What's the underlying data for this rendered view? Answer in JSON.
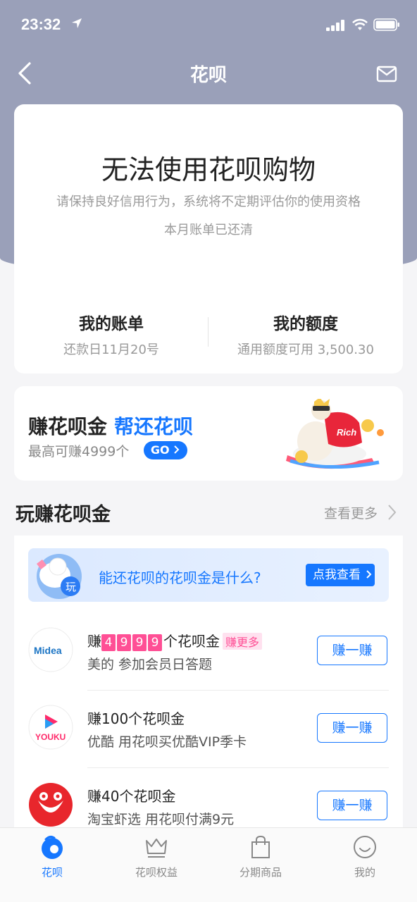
{
  "status_bar": {
    "time": "23:32"
  },
  "nav": {
    "title": "花呗"
  },
  "status_card": {
    "title": "无法使用花呗购物",
    "description": "请保持良好信用行为，系统将不定期评估你的使用资格",
    "note": "本月账单已还清",
    "bill": {
      "title": "我的账单",
      "subtitle": "还款日11月20号"
    },
    "limit": {
      "title": "我的额度",
      "subtitle": "通用额度可用 3,500.30"
    }
  },
  "promo": {
    "title": "赚花呗金",
    "title_highlight": "帮还花呗",
    "subtitle": "最高可赚4999个",
    "go_label": "GO",
    "mascot_text": "Rich"
  },
  "section": {
    "title": "玩赚花呗金",
    "more_label": "查看更多"
  },
  "banner": {
    "text": "能还花呗的花呗金是什么?",
    "button": "点我查看",
    "icon_text": "玩"
  },
  "tasks": [
    {
      "title_prefix": "赚",
      "digits": [
        "4",
        "9",
        "9",
        "9"
      ],
      "title_suffix": "个花呗金",
      "badge": "赚更多",
      "subtitle": "美的 参加会员日答题",
      "logo_text": "Midea",
      "button": "赚一赚"
    },
    {
      "title": "赚100个花呗金",
      "subtitle": "优酷 用花呗买优酷VIP季卡",
      "logo_text": "YOUKU",
      "button": "赚一赚"
    },
    {
      "title": "赚40个花呗金",
      "subtitle": "淘宝虾选 用花呗付满9元",
      "button": "赚一赚"
    }
  ],
  "tabs": [
    {
      "label": "花呗",
      "icon": "huabei-icon",
      "active": true
    },
    {
      "label": "花呗权益",
      "icon": "crown-icon"
    },
    {
      "label": "分期商品",
      "icon": "shopping-bag-icon"
    },
    {
      "label": "我的",
      "icon": "smiley-icon"
    }
  ],
  "colors": {
    "header": "#9aa0b9",
    "accent": "#1677ff",
    "pink": "#ff4f95"
  }
}
